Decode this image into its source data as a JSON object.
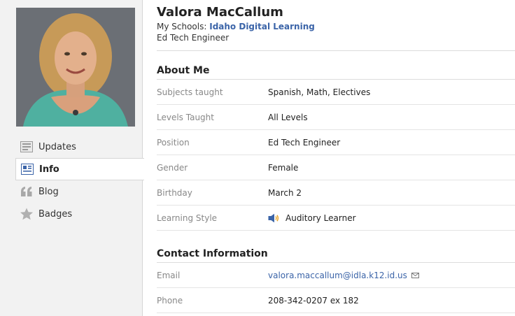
{
  "profile": {
    "name": "Valora MacCallum",
    "schools_label": "My Schools:",
    "school_name": "Idaho Digital Learning",
    "title": "Ed Tech Engineer"
  },
  "nav": {
    "items": [
      {
        "label": "Updates",
        "icon": "updates-icon"
      },
      {
        "label": "Info",
        "icon": "info-icon",
        "active": true
      },
      {
        "label": "Blog",
        "icon": "quote-icon"
      },
      {
        "label": "Badges",
        "icon": "star-icon"
      }
    ]
  },
  "about": {
    "heading": "About Me",
    "rows": [
      {
        "key": "Subjects taught",
        "value": "Spanish, Math, Electives"
      },
      {
        "key": "Levels Taught",
        "value": "All Levels"
      },
      {
        "key": "Position",
        "value": "Ed Tech Engineer"
      },
      {
        "key": "Gender",
        "value": "Female"
      },
      {
        "key": "Birthday",
        "value": "March 2"
      },
      {
        "key": "Learning Style",
        "value": "Auditory Learner",
        "icon": "speaker-icon"
      }
    ]
  },
  "contact": {
    "heading": "Contact Information",
    "rows": [
      {
        "key": "Email",
        "value": "valora.maccallum@idla.k12.id.us",
        "icon": "envelope-icon"
      },
      {
        "key": "Phone",
        "value": "208-342-0207 ex 182"
      }
    ]
  },
  "colors": {
    "link": "#3b64a8",
    "sidebar_bg": "#f2f2f2",
    "label_gray": "#888888"
  }
}
